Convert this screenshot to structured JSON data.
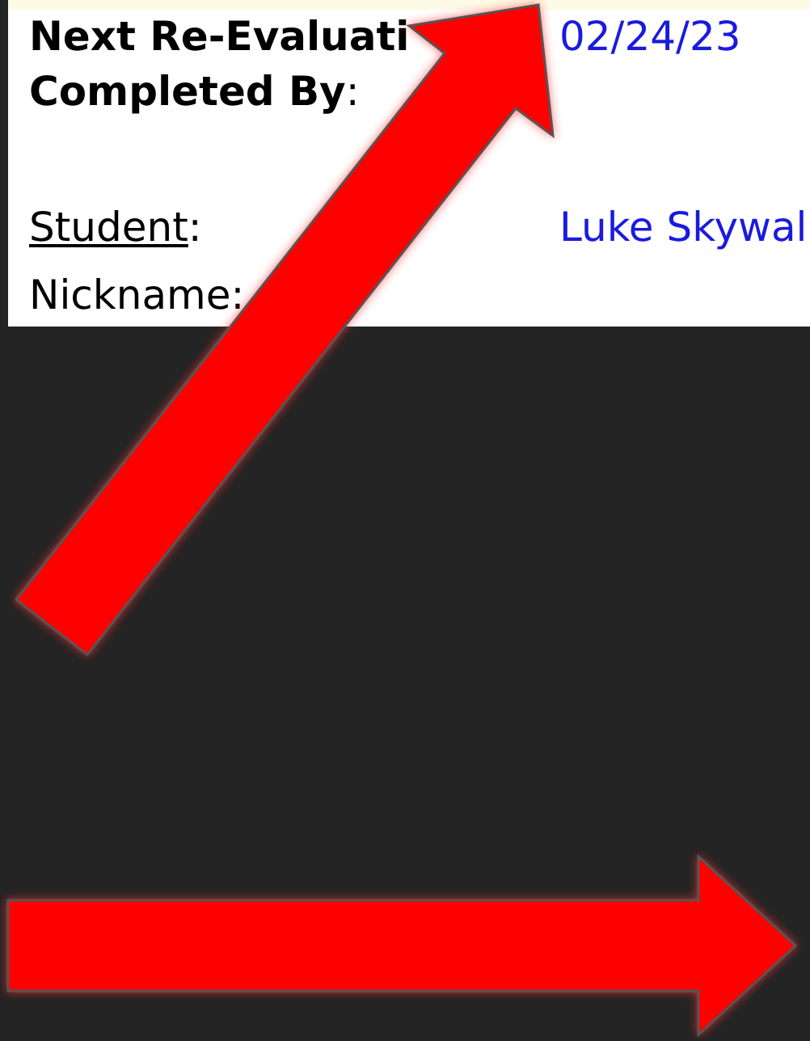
{
  "form": {
    "rows": [
      {
        "label": "Next Re-Evaluati",
        "colon": "",
        "kind": "heading",
        "value": "02/24/23"
      },
      {
        "label": "Completed By",
        "colon": ":",
        "kind": "heading",
        "value": ""
      },
      {
        "label": "Student",
        "colon": ":",
        "kind": "linked",
        "value": "Luke Skywal"
      },
      {
        "label": "Nickname",
        "colon": ":",
        "kind": "plain",
        "value": ""
      }
    ]
  }
}
